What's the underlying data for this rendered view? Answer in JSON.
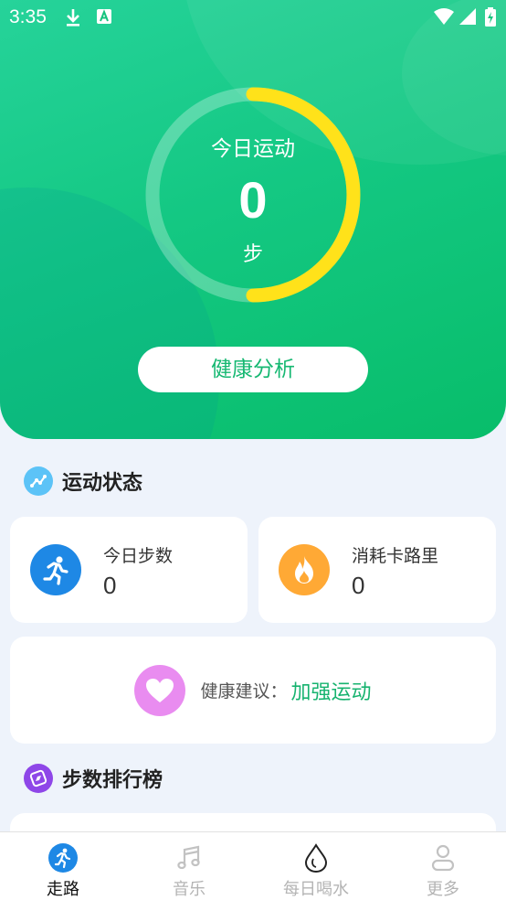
{
  "status_bar": {
    "time": "3:35"
  },
  "today": {
    "title": "今日运动",
    "steps": "0",
    "unit": "步",
    "progress": 0.5
  },
  "analysis_button": "健康分析",
  "sections": {
    "status_title": "运动状态",
    "ranking_title": "步数排行榜"
  },
  "stats": [
    {
      "label": "今日步数",
      "value": "0"
    },
    {
      "label": "消耗卡路里",
      "value": "0"
    }
  ],
  "advice": {
    "label": "健康建议：",
    "value": "加强运动"
  },
  "tabs": [
    {
      "label": "走路",
      "icon": "walk-icon",
      "active": true
    },
    {
      "label": "音乐",
      "icon": "music-note-icon",
      "active": false
    },
    {
      "label": "每日喝水",
      "icon": "water-drop-icon",
      "active": false
    },
    {
      "label": "更多",
      "icon": "person-icon",
      "active": false
    }
  ],
  "colors": {
    "accent_green": "#16b872",
    "ring_yellow": "#ffe21a",
    "stat_blue": "#1e88e5",
    "stat_orange": "#ffa935",
    "heart_pink": "#e98cf0",
    "section_status_blue": "#5cc3f7",
    "section_ranking_purple": "#8e46e8"
  }
}
